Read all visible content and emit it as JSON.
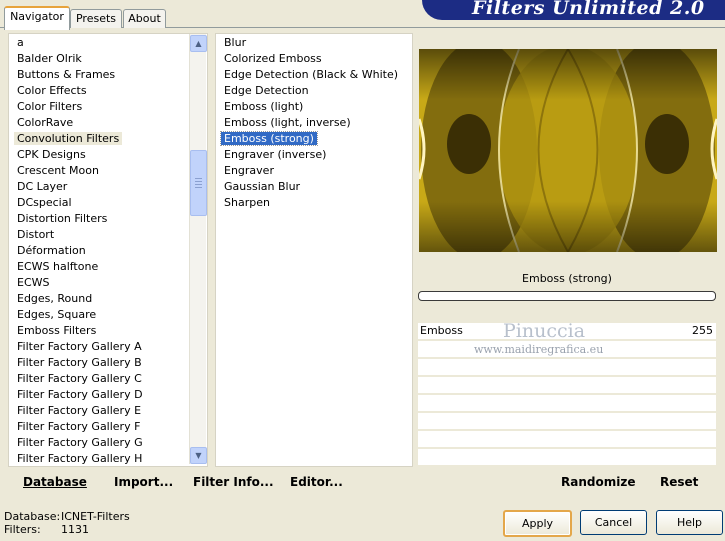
{
  "window": {
    "title": "Filters Unlimited 2.0"
  },
  "tabs": [
    {
      "label": "Navigator"
    },
    {
      "label": "Presets"
    },
    {
      "label": "About"
    }
  ],
  "categories": [
    "a",
    "Balder Olrik",
    "Buttons & Frames",
    "Color Effects",
    "Color Filters",
    "ColorRave",
    "Convolution Filters",
    "CPK Designs",
    "Crescent Moon",
    "DC Layer",
    "DCspecial",
    "Distortion Filters",
    "Distort",
    "Déformation",
    "ECWS halftone",
    "ECWS",
    "Edges, Round",
    "Edges, Square",
    "Emboss Filters",
    "Filter Factory Gallery A",
    "Filter Factory Gallery B",
    "Filter Factory Gallery C",
    "Filter Factory Gallery D",
    "Filter Factory Gallery E",
    "Filter Factory Gallery F",
    "Filter Factory Gallery G",
    "Filter Factory Gallery H"
  ],
  "selected_category": "Convolution Filters",
  "filters": [
    "Blur",
    "Colorized Emboss",
    "Edge Detection (Black & White)",
    "Edge Detection",
    "Emboss (light)",
    "Emboss (light, inverse)",
    "Emboss (strong)",
    "Engraver (inverse)",
    "Engraver",
    "Gaussian Blur",
    "Sharpen"
  ],
  "selected_filter": "Emboss (strong)",
  "preview": {
    "filter_name": "Emboss (strong)",
    "progress": 0
  },
  "params": [
    {
      "label": "Emboss",
      "value": "255"
    }
  ],
  "watermark": {
    "name": "Pinuccia",
    "url": "www.maidiregrafica.eu"
  },
  "bottom": {
    "database": "Database",
    "import": "Import...",
    "filter_info": "Filter Info...",
    "editor": "Editor...",
    "randomize": "Randomize",
    "reset": "Reset"
  },
  "status": {
    "database_label": "Database:",
    "database_value": "ICNET-Filters",
    "filters_label": "Filters:",
    "filters_value": "1131"
  },
  "buttons": {
    "apply": "Apply",
    "cancel": "Cancel",
    "help": "Help"
  },
  "colors": {
    "selection": "#316ac5",
    "banner": "#1c2c84",
    "preview_tint": "#c9ab16"
  }
}
